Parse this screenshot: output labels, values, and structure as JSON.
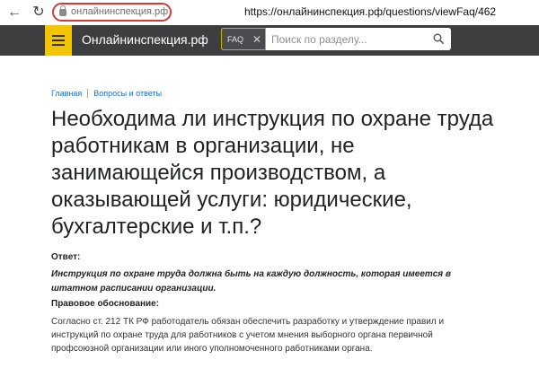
{
  "browser": {
    "back_icon": "←",
    "reload_icon": "↻",
    "domain_chip": "онлайнинспекция.рф",
    "url": "https://онлайнинспекция.рф/questions/viewFaq/462"
  },
  "header": {
    "site_name": "Онлайнинспекция.рф",
    "faq_tag": "FAQ",
    "faq_clear": "✕",
    "search_placeholder": "Поиск по разделу...",
    "accent_color": "#f2c500",
    "header_color": "#3d3e40"
  },
  "breadcrumb": {
    "home": "Главная",
    "section": "Вопросы и ответы"
  },
  "article": {
    "title": "Необходима ли инструкция по охране труда работникам в организации, не занимающейся производством, а оказывающей услуги: юридические, бухгалтерские и т.п.?",
    "answer_label": "Ответ:",
    "answer_text": "Инструкция по охране труда должна быть на каждую должность, которая имеется в штатном расписании организации.",
    "legal_label": "Правовое обоснование:",
    "legal_text": "Согласно ст. 212 ТК РФ работодатель обязан обеспечить разработку и утверждение правил и инструкций по охране труда для работников с учетом мнения выборного органа первичной профсоюзной организации или иного уполномоченного работниками органа."
  }
}
